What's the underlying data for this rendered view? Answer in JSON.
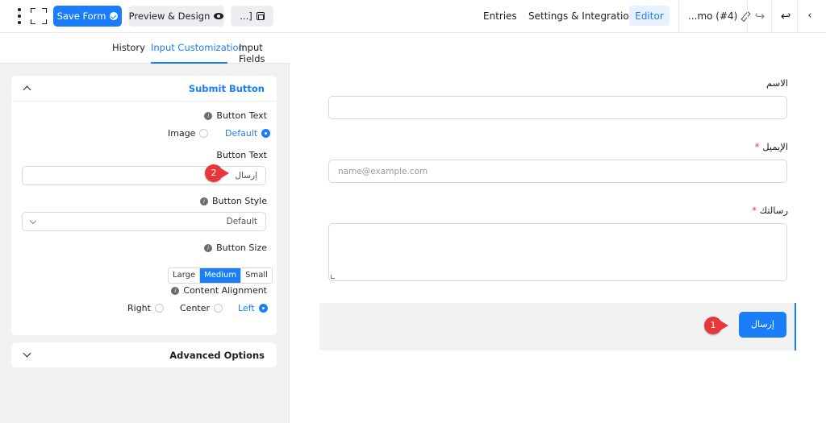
{
  "toolbar": {
    "save_label": "Save Form",
    "preview_label": "Preview & Design",
    "shortcode_label": "...]",
    "nav": [
      "Entries",
      "Settings & Integrations",
      "Editor"
    ],
    "form_title": "...mo (#4)"
  },
  "sidebar": {
    "tabs": [
      "History",
      "Input Customization",
      "Input Fields"
    ],
    "submit_section": {
      "title": "Submit Button",
      "button_text_type_label": "Button Text",
      "type_options": [
        "Image",
        "Default"
      ],
      "type_selected": "Default",
      "button_text_label": "Button Text",
      "button_text_value": "إرسال",
      "button_style_label": "Button Style",
      "button_style_value": "Default",
      "button_size_label": "Button Size",
      "size_options": [
        "Large",
        "Medium",
        "Small"
      ],
      "size_selected": "Medium",
      "alignment_label": "Content Alignment",
      "alignment_options": [
        "Right",
        "Center",
        "Left"
      ],
      "alignment_selected": "Left"
    },
    "advanced_title": "Advanced Options"
  },
  "form": {
    "name_label": "الاسم",
    "email_label": "الإيميل",
    "email_placeholder": "name@example.com",
    "message_label": "رسالتك",
    "required_mark": "*",
    "submit_label": "إرسال"
  },
  "annotations": [
    "1",
    "2"
  ],
  "colors": {
    "accent": "#1a7efb",
    "badge": "#e8363a"
  }
}
